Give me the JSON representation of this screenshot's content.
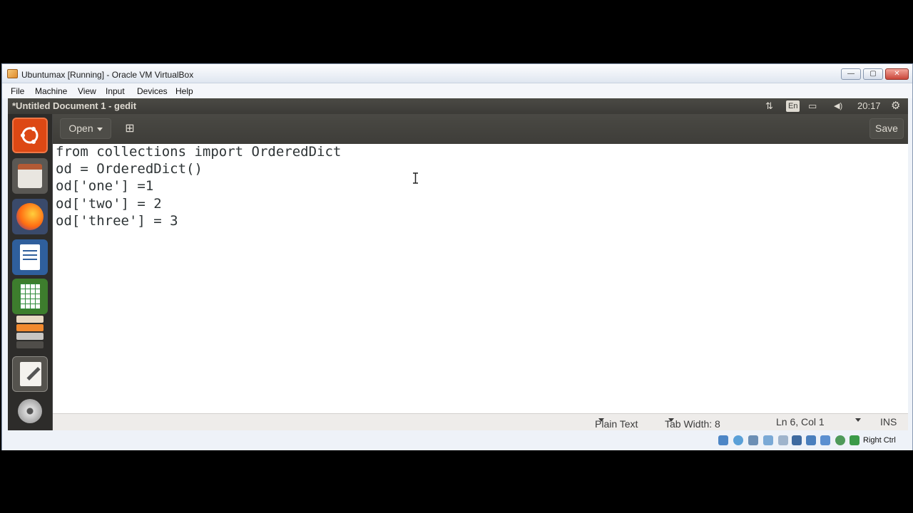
{
  "host_window": {
    "title": "Ubuntumax [Running] - Oracle VM VirtualBox",
    "menu": [
      "File",
      "Machine",
      "View",
      "Input",
      "Devices",
      "Help"
    ],
    "controls": {
      "minimize": "—",
      "maximize": "▢",
      "close": "✕"
    }
  },
  "ubuntu_topbar": {
    "window_title": "*Untitled Document 1 - gedit",
    "network_glyph": "⇅",
    "keyboard_layout": "En",
    "battery_glyph": "▭",
    "volume_glyph": "◀)",
    "clock": "20:17",
    "settings_glyph": "⚙"
  },
  "launcher": {
    "items": [
      "ubuntu-dash",
      "files",
      "firefox",
      "writer",
      "calc",
      "stacked-apps",
      "text-editor",
      "disc"
    ]
  },
  "gedit_toolbar": {
    "open_label": "Open",
    "new_tab_glyph": "⊞",
    "save_label": "Save"
  },
  "editor": {
    "lines": [
      "from collections import OrderedDict",
      "od = OrderedDict()",
      "od['one'] =1",
      "od['two'] = 2",
      "od['three'] = 3"
    ]
  },
  "statusbar": {
    "language": "Plain Text",
    "tab_width": "Tab Width: 8",
    "position": "Ln 6, Col 1",
    "mode": "INS"
  },
  "vbox_status": {
    "host_key": "Right Ctrl"
  }
}
